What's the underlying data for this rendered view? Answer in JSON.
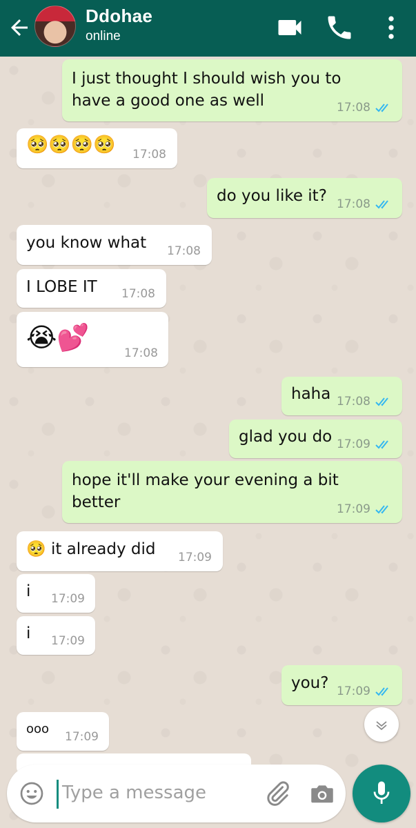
{
  "header": {
    "contact_name": "Ddohae",
    "status": "online"
  },
  "messages": [
    {
      "dir": "out",
      "text_line1": "I just thought I should wish you to",
      "text_line2": "have a good one as well",
      "time": "17:08",
      "read": true
    },
    {
      "dir": "in",
      "text": "🥺🥺🥺🥺",
      "time": "17:08"
    },
    {
      "dir": "out",
      "text": "do you like it?",
      "time": "17:08",
      "read": true
    },
    {
      "dir": "in",
      "text": "you know what",
      "time": "17:08"
    },
    {
      "dir": "in",
      "text": "I LOBE IT",
      "time": "17:08"
    },
    {
      "dir": "in",
      "text": "😭💕",
      "time": "17:08"
    },
    {
      "dir": "out",
      "text": "haha",
      "time": "17:08",
      "read": true
    },
    {
      "dir": "out",
      "text": "glad you do",
      "time": "17:09",
      "read": true
    },
    {
      "dir": "out",
      "text_line1": "hope it'll make your evening a bit",
      "text_line2": "better",
      "time": "17:09",
      "read": true
    },
    {
      "dir": "in",
      "text": "🥺 it already did",
      "time": "17:09"
    },
    {
      "dir": "in",
      "text": "i",
      "time": "17:09"
    },
    {
      "dir": "in",
      "text": "i",
      "time": "17:09"
    },
    {
      "dir": "out",
      "text": "you?",
      "time": "17:09",
      "read": true
    },
    {
      "dir": "in",
      "text": "ooo",
      "time": "17:09"
    }
  ],
  "input": {
    "placeholder": "Type a message"
  },
  "icons": {
    "back": "arrow-left-icon",
    "video": "video-camera-icon",
    "call": "phone-icon",
    "menu": "more-vertical-icon",
    "emoji": "smiley-icon",
    "attach": "paperclip-icon",
    "camera": "camera-icon",
    "mic": "microphone-icon",
    "scroll": "chevron-double-down-icon"
  },
  "colors": {
    "header": "#075e54",
    "outgoing_bubble": "#dcf8c6",
    "incoming_bubble": "#ffffff",
    "read_ticks": "#34b7f1",
    "mic_button": "#128c7e"
  }
}
